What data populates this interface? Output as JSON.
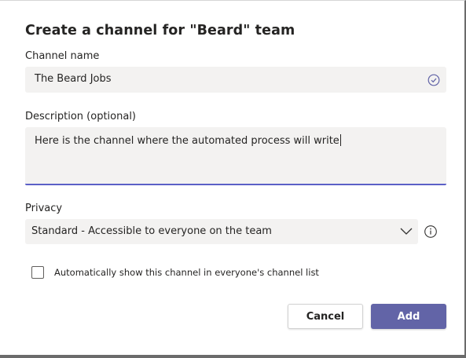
{
  "dialog": {
    "title": "Create a channel for \"Beard\" team"
  },
  "channel_name": {
    "label": "Channel name",
    "value": "The Beard Jobs",
    "status_icon": "check-circle-icon"
  },
  "description": {
    "label": "Description (optional)",
    "value": "Here is the channel where the automated process will write"
  },
  "privacy": {
    "label": "Privacy",
    "selected": "Standard - Accessible to everyone on the team",
    "dropdown_icon": "chevron-down-icon",
    "info_icon": "info-icon"
  },
  "auto_show": {
    "label": "Automatically show this channel in everyone's channel list",
    "checked": false
  },
  "buttons": {
    "cancel": "Cancel",
    "add": "Add"
  },
  "colors": {
    "accent": "#6264a7",
    "field_bg": "#f3f2f1"
  }
}
